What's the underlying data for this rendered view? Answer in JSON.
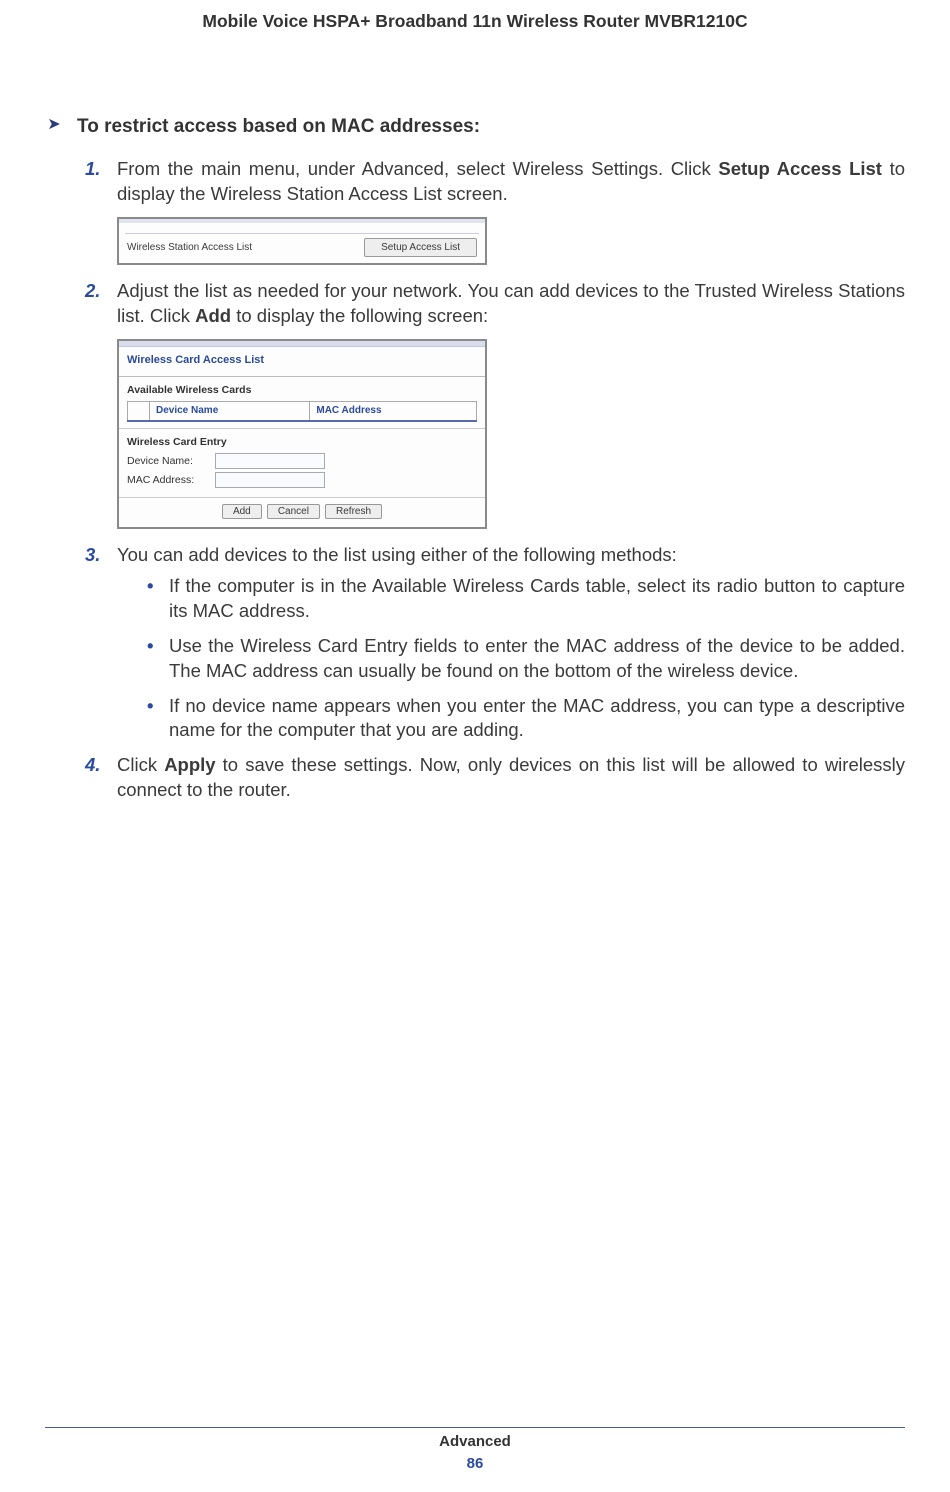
{
  "header": {
    "title": "Mobile Voice HSPA+ Broadband 11n Wireless Router MVBR1210C"
  },
  "procedure": {
    "title": "To restrict access based on MAC addresses:",
    "steps": {
      "s1": {
        "num": "1.",
        "pre": "From the main menu, under Advanced, select Wireless Settings. Click ",
        "bold1": "Setup Access List",
        "post": " to display the Wireless Station Access List screen."
      },
      "s2": {
        "num": "2.",
        "pre": "Adjust the list as needed for your network. You can add devices to the Trusted Wireless Stations list. Click ",
        "bold1": "Add",
        "post": " to display the following screen:"
      },
      "s3": {
        "num": "3.",
        "text": "You can add devices to the list using either of the following methods:",
        "bullets": {
          "b1": "If the computer is in the Available Wireless Cards table, select its radio button to capture its MAC address.",
          "b2": "Use the Wireless Card Entry fields to enter the MAC address of the device to be added. The MAC address can usually be found on the bottom of the wireless device.",
          "b3": "If no device name appears when you enter the MAC address, you can type a descriptive name for the computer that you are adding."
        }
      },
      "s4": {
        "num": "4.",
        "pre": "Click ",
        "bold1": "Apply",
        "post": " to save these settings. Now, only devices on this list will be allowed to wirelessly connect to the router."
      }
    }
  },
  "fig1": {
    "label": "Wireless Station Access List",
    "button": "Setup Access List"
  },
  "fig2": {
    "title": "Wireless Card Access List",
    "available_label": "Available Wireless Cards",
    "th_device": "Device Name",
    "th_mac": "MAC Address",
    "entry_label": "Wireless Card Entry",
    "device_name_label": "Device Name:",
    "mac_label": "MAC Address:",
    "buttons": {
      "add": "Add",
      "cancel": "Cancel",
      "refresh": "Refresh"
    }
  },
  "footer": {
    "section": "Advanced",
    "page": "86"
  }
}
